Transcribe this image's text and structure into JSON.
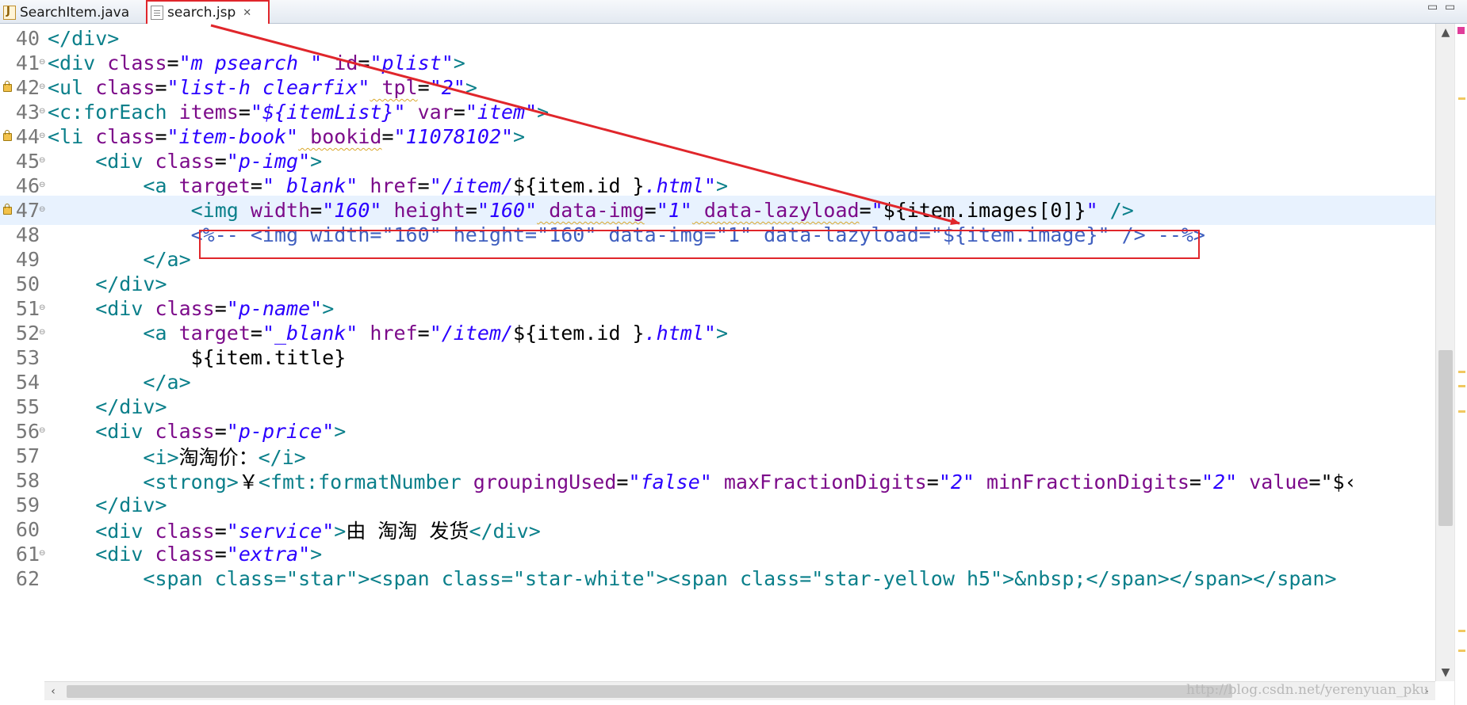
{
  "tabs": [
    {
      "label": "SearchItem.java",
      "icon": "java-file-icon",
      "active": false
    },
    {
      "label": "search.jsp",
      "icon": "jsp-file-icon",
      "active": true,
      "close": "✕"
    }
  ],
  "window_controls": {
    "minimize": "▭",
    "maximize": "▭"
  },
  "editor": {
    "lines": [
      {
        "num": "40"
      },
      {
        "num": "41"
      },
      {
        "num": "42"
      },
      {
        "num": "43"
      },
      {
        "num": "44"
      },
      {
        "num": "45"
      },
      {
        "num": "46"
      },
      {
        "num": "47"
      },
      {
        "num": "48"
      },
      {
        "num": "49"
      },
      {
        "num": "50"
      },
      {
        "num": "51"
      },
      {
        "num": "52"
      },
      {
        "num": "53"
      },
      {
        "num": "54"
      },
      {
        "num": "55"
      },
      {
        "num": "56"
      },
      {
        "num": "57"
      },
      {
        "num": "58"
      },
      {
        "num": "59"
      },
      {
        "num": "60"
      },
      {
        "num": "61"
      },
      {
        "num": "62"
      }
    ],
    "t": {
      "l40_a": "</div>",
      "l41_a": "<div",
      "l41_b": " class",
      "l41_c": "=",
      "l41_d": "\"m psearch \"",
      "l41_e": " id",
      "l41_f": "=",
      "l41_g": "\"plist\"",
      "l41_h": ">",
      "l42_a": "<ul",
      "l42_b": " class",
      "l42_c": "=",
      "l42_d": "\"list-h clearfix\"",
      "l42_e": " tpl",
      "l42_f": "=",
      "l42_g": "\"2\"",
      "l42_h": ">",
      "l43_a": "<c:forEach",
      "l43_b": " items",
      "l43_c": "=",
      "l43_d": "\"${itemList}\"",
      "l43_e": " var",
      "l43_f": "=",
      "l43_g": "\"item\"",
      "l43_h": ">",
      "l44_a": "<li",
      "l44_b": " class",
      "l44_c": "=",
      "l44_d": "\"item-book\"",
      "l44_e": " bookid",
      "l44_f": "=",
      "l44_g": "\"11078102\"",
      "l44_h": ">",
      "l45_a": "    <div",
      "l45_b": " class",
      "l45_c": "=",
      "l45_d": "\"p-img\"",
      "l45_e": ">",
      "l46_a": "        <a",
      "l46_b": " target",
      "l46_c": "=",
      "l46_d": "\"_blank\"",
      "l46_e": " href",
      "l46_f": "=",
      "l46_g": "\"/item/",
      "l46_h": "${item.id }",
      "l46_i": ".html\"",
      "l46_j": ">",
      "l47_a": "            <img",
      "l47_b": " width",
      "l47_c": "=",
      "l47_d": "\"160\"",
      "l47_e": " height",
      "l47_f": "=",
      "l47_g": "\"160\"",
      "l47_h": " data-img",
      "l47_i": "=",
      "l47_j": "\"1\"",
      "l47_k": " data-lazyload",
      "l47_l": "=",
      "l47_m": "\"",
      "l47_n": "${item.images[0]}",
      "l47_o": "\"",
      "l47_p": " />",
      "l48_a": "            ",
      "l48_b": "<%-- <img width=\"160\" height=\"160\" data-img=\"1\" data-lazyload=\"${item.image}\" /> --%>",
      "l49_a": "        </a>",
      "l50_a": "    </div>",
      "l51_a": "    <div",
      "l51_b": " class",
      "l51_c": "=",
      "l51_d": "\"p-name\"",
      "l51_e": ">",
      "l52_a": "        <a",
      "l52_b": " target",
      "l52_c": "=",
      "l52_d": "\"_blank\"",
      "l52_e": " href",
      "l52_f": "=",
      "l52_g": "\"/item/",
      "l52_h": "${item.id }",
      "l52_i": ".html\"",
      "l52_j": ">",
      "l53_a": "            ${item.title}",
      "l54_a": "        </a>",
      "l55_a": "    </div>",
      "l56_a": "    <div",
      "l56_b": " class",
      "l56_c": "=",
      "l56_d": "\"p-price\"",
      "l56_e": ">",
      "l57_a": "        <i>",
      "l57_b": "淘淘价：",
      "l57_c": "</i>",
      "l58_a": "        <strong>",
      "l58_b": "￥",
      "l58_c": "<fmt:formatNumber",
      "l58_d": " groupingUsed",
      "l58_e": "=",
      "l58_f": "\"false\"",
      "l58_g": " maxFractionDigits",
      "l58_h": "=",
      "l58_i": "\"2\"",
      "l58_j": " minFractionDigits",
      "l58_k": "=",
      "l58_l": "\"2\"",
      "l58_m": " value",
      "l58_n": "=",
      "l58_o": "\"$‹",
      "l59_a": "    </div>",
      "l60_a": "    <div",
      "l60_b": " class",
      "l60_c": "=",
      "l60_d": "\"service\"",
      "l60_e": ">",
      "l60_f": "由 淘淘 发货",
      "l60_g": "</div>",
      "l61_a": "    <div",
      "l61_b": " class",
      "l61_c": "=",
      "l61_d": "\"extra\"",
      "l61_e": ">",
      "l62_a": "        <span class=\"star\"><span class=\"star-white\"><span class=\"star-yellow h5\">&nbsp;</span></span></span>"
    }
  },
  "scrollbar": {
    "up": "▲",
    "down": "▼",
    "left": "‹",
    "right": "›"
  },
  "watermark": "http://blog.csdn.net/yerenyuan_pku",
  "colors": {
    "annotation": "#e0262b",
    "tag": "#0a7f8a",
    "attribute": "#7c0b8a",
    "string": "#2a00ff",
    "comment": "#3f5fbf",
    "current_line": "#e8f2fe"
  }
}
